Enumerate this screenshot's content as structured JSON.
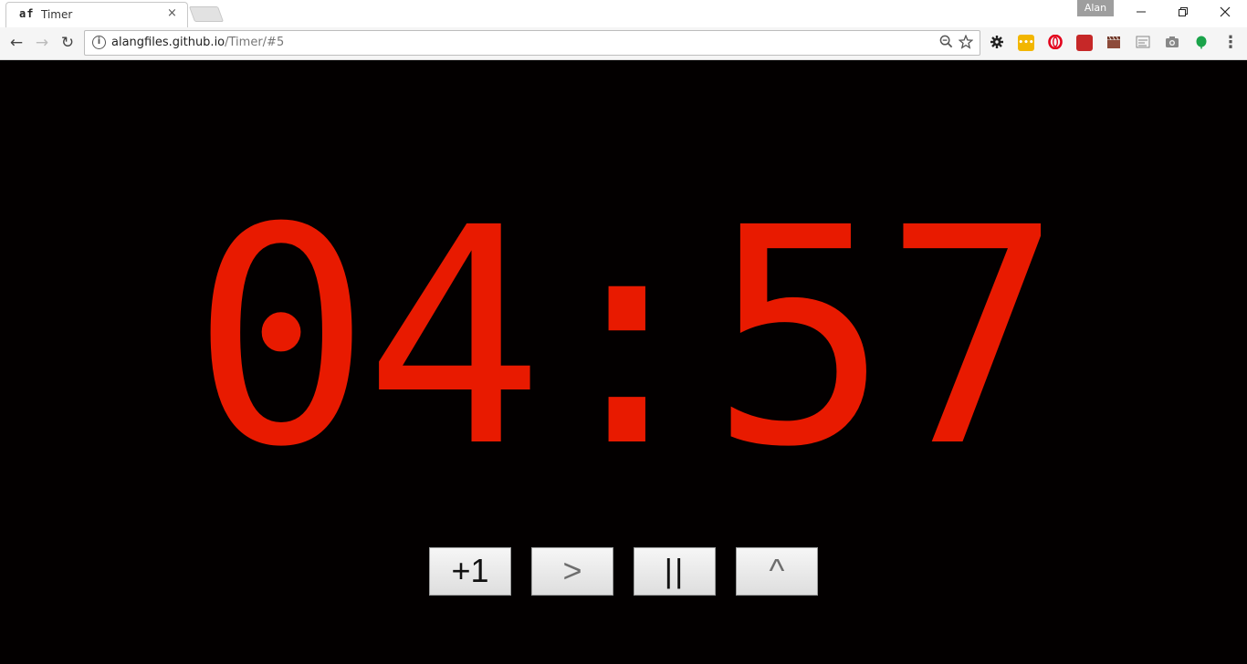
{
  "browser": {
    "tab": {
      "favicon_text": "af",
      "title": "Timer",
      "close_glyph": "×"
    },
    "profile_name": "Alan",
    "window_controls": {
      "minimize": "—",
      "restore": "❐",
      "close": "✕"
    },
    "nav": {
      "back": "←",
      "forward": "→",
      "reload": "↻"
    },
    "address": {
      "host": "alangfiles.github.io",
      "path": "/Timer/#5"
    },
    "omnibox_icons": {
      "zoom": "zoom-out-icon",
      "star": "star-icon"
    },
    "extensions": [
      "gear-extension",
      "yellow-extension",
      "opera-extension",
      "red-book-extension",
      "clapper-extension",
      "web-clipper-extension",
      "camera-extension",
      "green-leaf-extension"
    ],
    "menu_glyph": "⋮"
  },
  "timer": {
    "display": "04:57",
    "color": "#e81a00"
  },
  "controls": [
    {
      "label": "+1",
      "name": "add-minute-button"
    },
    {
      "label": ">",
      "name": "start-button"
    },
    {
      "label": "||",
      "name": "pause-button"
    },
    {
      "label": "^",
      "name": "up-button"
    }
  ]
}
